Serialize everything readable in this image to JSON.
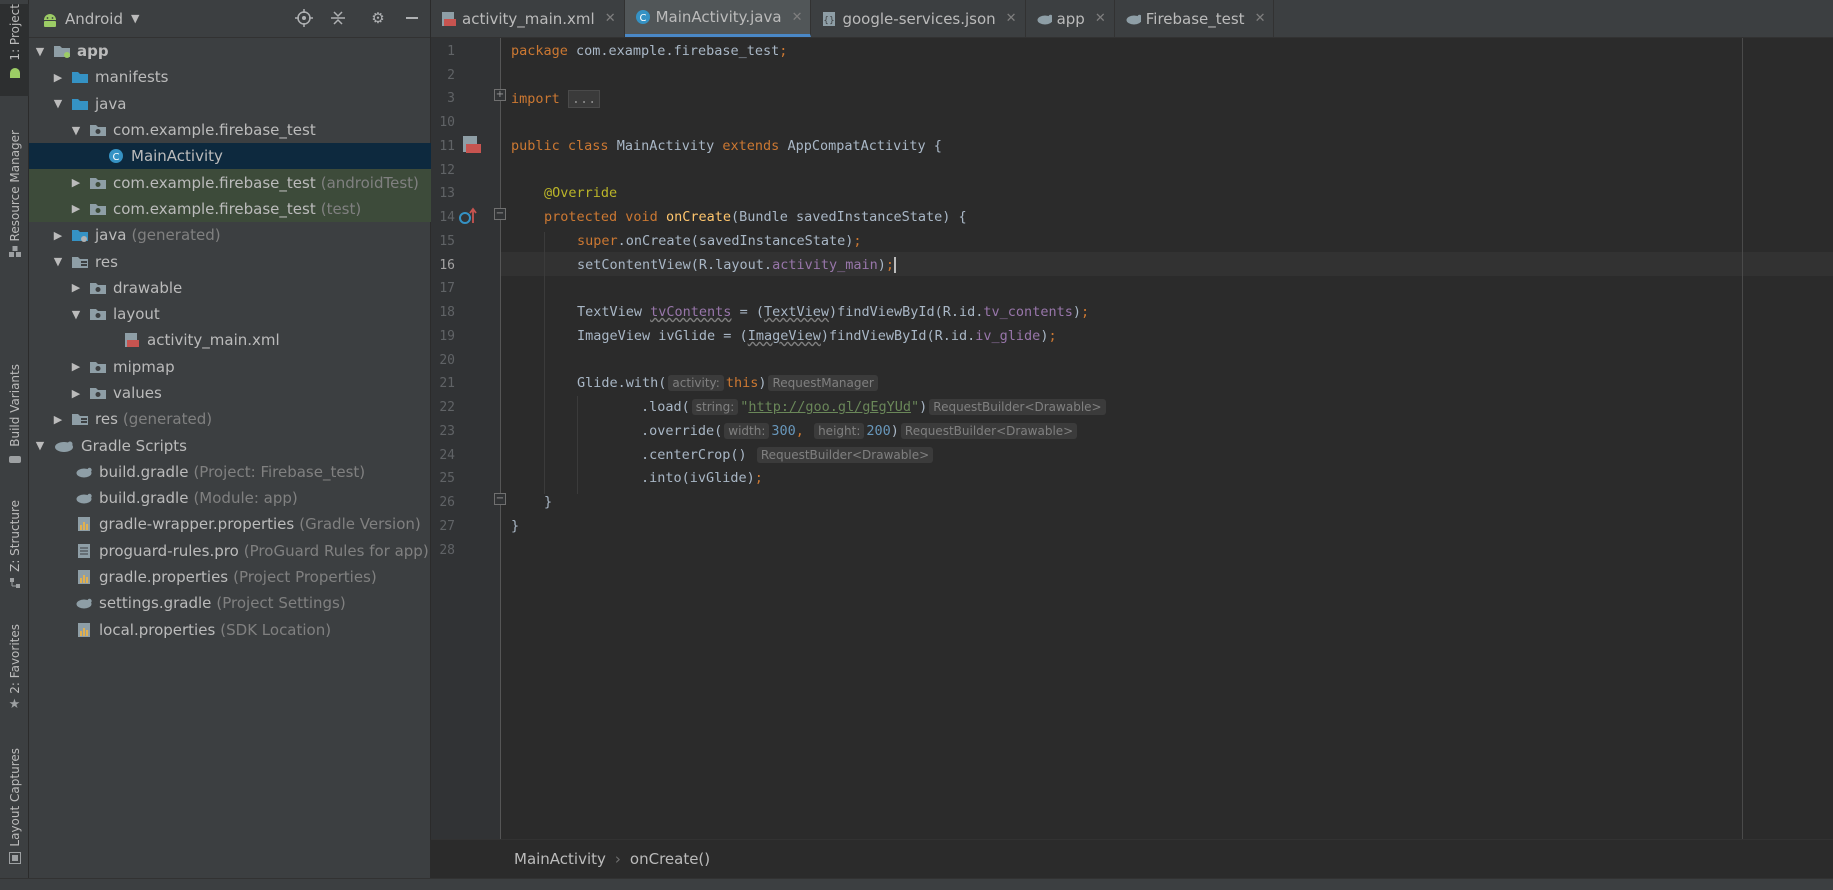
{
  "tool_strip": {
    "tabs": [
      {
        "label": "1: Project",
        "icon": "android-icon"
      },
      {
        "label": "Resource Manager",
        "icon": "resource-manager-icon"
      },
      {
        "label": "Build Variants",
        "icon": "build-variants-icon"
      },
      {
        "label": "Z: Structure",
        "icon": "structure-icon"
      },
      {
        "label": "2: Favorites",
        "icon": "star-icon"
      },
      {
        "label": "Layout Captures",
        "icon": "layout-captures-icon"
      }
    ]
  },
  "project_panel": {
    "view_label": "Android",
    "tree": [
      {
        "name": "app",
        "suffix": ""
      },
      {
        "name": "manifests",
        "suffix": ""
      },
      {
        "name": "java",
        "suffix": ""
      },
      {
        "name": "com.example.firebase_test",
        "suffix": ""
      },
      {
        "name": "MainActivity",
        "suffix": ""
      },
      {
        "name": "com.example.firebase_test",
        "suffix": "(androidTest)"
      },
      {
        "name": "com.example.firebase_test",
        "suffix": "(test)"
      },
      {
        "name": "java",
        "suffix": "(generated)"
      },
      {
        "name": "res",
        "suffix": ""
      },
      {
        "name": "drawable",
        "suffix": ""
      },
      {
        "name": "layout",
        "suffix": ""
      },
      {
        "name": "activity_main.xml",
        "suffix": ""
      },
      {
        "name": "mipmap",
        "suffix": ""
      },
      {
        "name": "values",
        "suffix": ""
      },
      {
        "name": "res",
        "suffix": "(generated)"
      },
      {
        "name": "Gradle Scripts",
        "suffix": ""
      },
      {
        "name": "build.gradle",
        "suffix": "(Project: Firebase_test)"
      },
      {
        "name": "build.gradle",
        "suffix": "(Module: app)"
      },
      {
        "name": "gradle-wrapper.properties",
        "suffix": "(Gradle Version)"
      },
      {
        "name": "proguard-rules.pro",
        "suffix": "(ProGuard Rules for app)"
      },
      {
        "name": "gradle.properties",
        "suffix": "(Project Properties)"
      },
      {
        "name": "settings.gradle",
        "suffix": "(Project Settings)"
      },
      {
        "name": "local.properties",
        "suffix": "(SDK Location)"
      }
    ]
  },
  "tabs": [
    {
      "label": "activity_main.xml",
      "icon": "xml-file-icon"
    },
    {
      "label": "MainActivity.java",
      "icon": "java-class-icon"
    },
    {
      "label": "google-services.json",
      "icon": "json-file-icon"
    },
    {
      "label": "app",
      "icon": "gradle-icon"
    },
    {
      "label": "Firebase_test",
      "icon": "gradle-icon"
    }
  ],
  "editor": {
    "line_numbers": [
      "1",
      "2",
      "3",
      "10",
      "11",
      "12",
      "13",
      "14",
      "15",
      "16",
      "17",
      "18",
      "19",
      "20",
      "21",
      "22",
      "23",
      "24",
      "25",
      "26",
      "27",
      "28"
    ],
    "current_line": "16",
    "code": {
      "l1_kw": "package",
      "l1_rest": " com.example.firebase_test",
      "l1_semi": ";",
      "l3_kw": "import",
      "l3_fold": "...",
      "l11_kw1": "public",
      "l11_kw2": "class",
      "l11_name": "MainActivity",
      "l11_kw3": "extends",
      "l11_super": "AppCompatActivity {",
      "l13_ann": "@Override",
      "l14_kw1": "protected",
      "l14_kw2": "void",
      "l14_fn": "onCreate",
      "l14_rest": "(Bundle savedInstanceState) {",
      "l15_kw": "super",
      "l15_rest": ".onCreate(savedInstanceState)",
      "l15_semi": ";",
      "l16_a": "setContentView(R.layout.",
      "l16_fld": "activity_main",
      "l16_b": ")",
      "l16_semi": ";",
      "l18_type": "TextView ",
      "l18_var": "tvContents",
      "l18_a": " = (",
      "l18_cast": "TextView",
      "l18_b": ")findViewById(R.id.",
      "l18_fld": "tv_contents",
      "l18_c": ")",
      "l18_semi": ";",
      "l19_type": "ImageView ivGlide = (",
      "l19_cast": "ImageView",
      "l19_b": ")findViewById(R.id.",
      "l19_fld": "iv_glide",
      "l19_c": ")",
      "l19_semi": ";",
      "l21_a": "Glide.with(",
      "l21_hint": "activity:",
      "l21_kw": "this",
      "l21_b": ")",
      "l21_ret": "RequestManager",
      "l22_a": ".load(",
      "l22_hint": "string:",
      "l22_q1": "\"",
      "l22_url": "http://goo.gl/gEgYUd",
      "l22_q2": "\"",
      "l22_b": ")",
      "l22_ret": "RequestBuilder<Drawable>",
      "l23_a": ".override(",
      "l23_hint1": "width:",
      "l23_n1": "300",
      "l23_comma": ",",
      "l23_hint2": "height:",
      "l23_n2": "200",
      "l23_b": ")",
      "l23_ret": "RequestBuilder<Drawable>",
      "l24_a": ".centerCrop()",
      "l24_ret": "RequestBuilder<Drawable>",
      "l25_a": ".into(ivGlide)",
      "l25_semi": ";",
      "l26": "}",
      "l27": "}"
    }
  },
  "breadcrumb": {
    "items": [
      "MainActivity",
      "onCreate()"
    ]
  }
}
